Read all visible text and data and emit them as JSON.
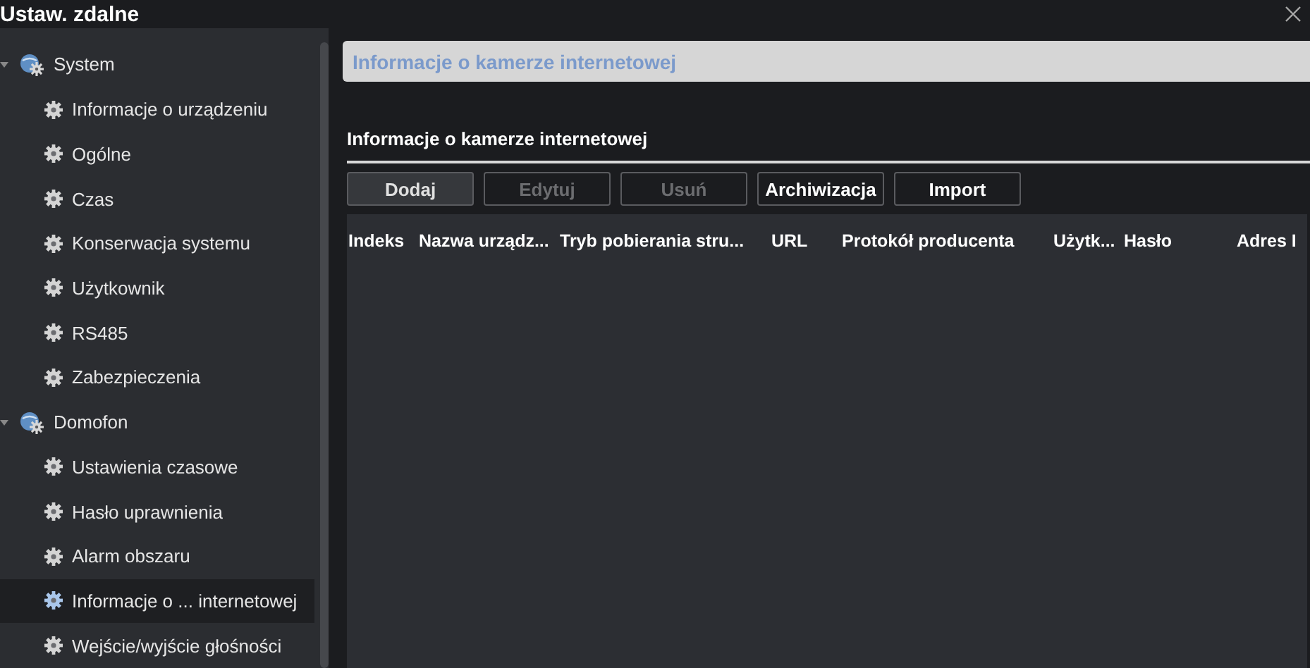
{
  "window": {
    "title": "Ustaw. zdalne"
  },
  "tree": [
    {
      "label": "System",
      "expanded": true,
      "children": [
        {
          "label": "Informacje o urządzeniu",
          "selected": false
        },
        {
          "label": "Ogólne",
          "selected": false
        },
        {
          "label": "Czas",
          "selected": false
        },
        {
          "label": "Konserwacja systemu",
          "selected": false
        },
        {
          "label": "Użytkownik",
          "selected": false
        },
        {
          "label": "RS485",
          "selected": false
        },
        {
          "label": "Zabezpieczenia",
          "selected": false
        }
      ]
    },
    {
      "label": "Domofon",
      "expanded": true,
      "children": [
        {
          "label": "Ustawienia czasowe",
          "selected": false
        },
        {
          "label": "Hasło uprawnienia",
          "selected": false
        },
        {
          "label": "Alarm obszaru",
          "selected": false
        },
        {
          "label": "Informacje o ... internetowej",
          "selected": true
        },
        {
          "label": "Wejście/wyjście głośności",
          "selected": false
        }
      ]
    }
  ],
  "page_header": "Informacje o kamerze internetowej",
  "section_title": "Informacje o kamerze internetowej",
  "buttons": [
    {
      "label": "Dodaj",
      "disabled": false,
      "focused": true
    },
    {
      "label": "Edytuj",
      "disabled": true,
      "focused": false
    },
    {
      "label": "Usuń",
      "disabled": true,
      "focused": false
    },
    {
      "label": "Archiwizacja",
      "disabled": false,
      "focused": false
    },
    {
      "label": "Import",
      "disabled": false,
      "focused": false
    }
  ],
  "table": {
    "columns": [
      "Indeks",
      "Nazwa urządz...",
      "Tryb pobierania stru...",
      "URL",
      "Protokół producenta",
      "Użytk...",
      "Hasło",
      "Adres I"
    ]
  }
}
